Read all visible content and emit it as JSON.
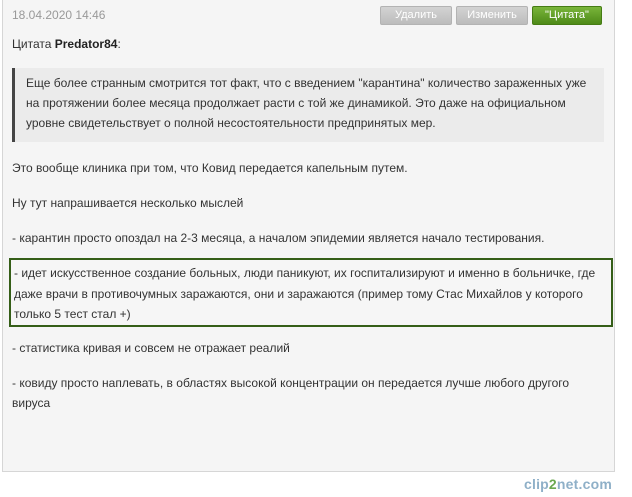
{
  "post": {
    "date": "18.04.2020 14:46",
    "buttons": {
      "delete": "Удалить",
      "edit": "Изменить",
      "quote": "\"Цитата\""
    },
    "quote_prefix": "Цитата",
    "quote_author": "Predator84",
    "quote_suffix": ":",
    "quote_text": "Еще более странным смотрится тот факт, что с введением \"карантина\" количество зараженных уже на протяжении более месяца продолжает расти с той же динамикой. Это даже на официальном уровне свидетельствует о полной несостоятельности предпринятых мер.",
    "paragraphs": {
      "p1": "Это вообще клиника при том, что Ковид передается капельным путем.",
      "p2": "Ну тут напрашивается несколько мыслей",
      "p3": "-  карантин просто опоздал на 2-3 месяца, а началом эпидемии является начало тестирования.",
      "highlighted": "- идет искусственное создание больных, люди паникуют, их госпитализируют и именно в больничке, где даже врачи в противочумных заражаются, они и заражаются  (пример тому Стас Михайлов у которого только 5 тест стал +)",
      "p4": "-  статистика кривая и совсем не отражает реалий",
      "p5": "-  ковиду просто наплевать, в областях высокой концентрации он передается лучше любого другого вируса"
    }
  },
  "watermark": {
    "part1": "clip",
    "part2": "2",
    "part3": "net.com"
  }
}
